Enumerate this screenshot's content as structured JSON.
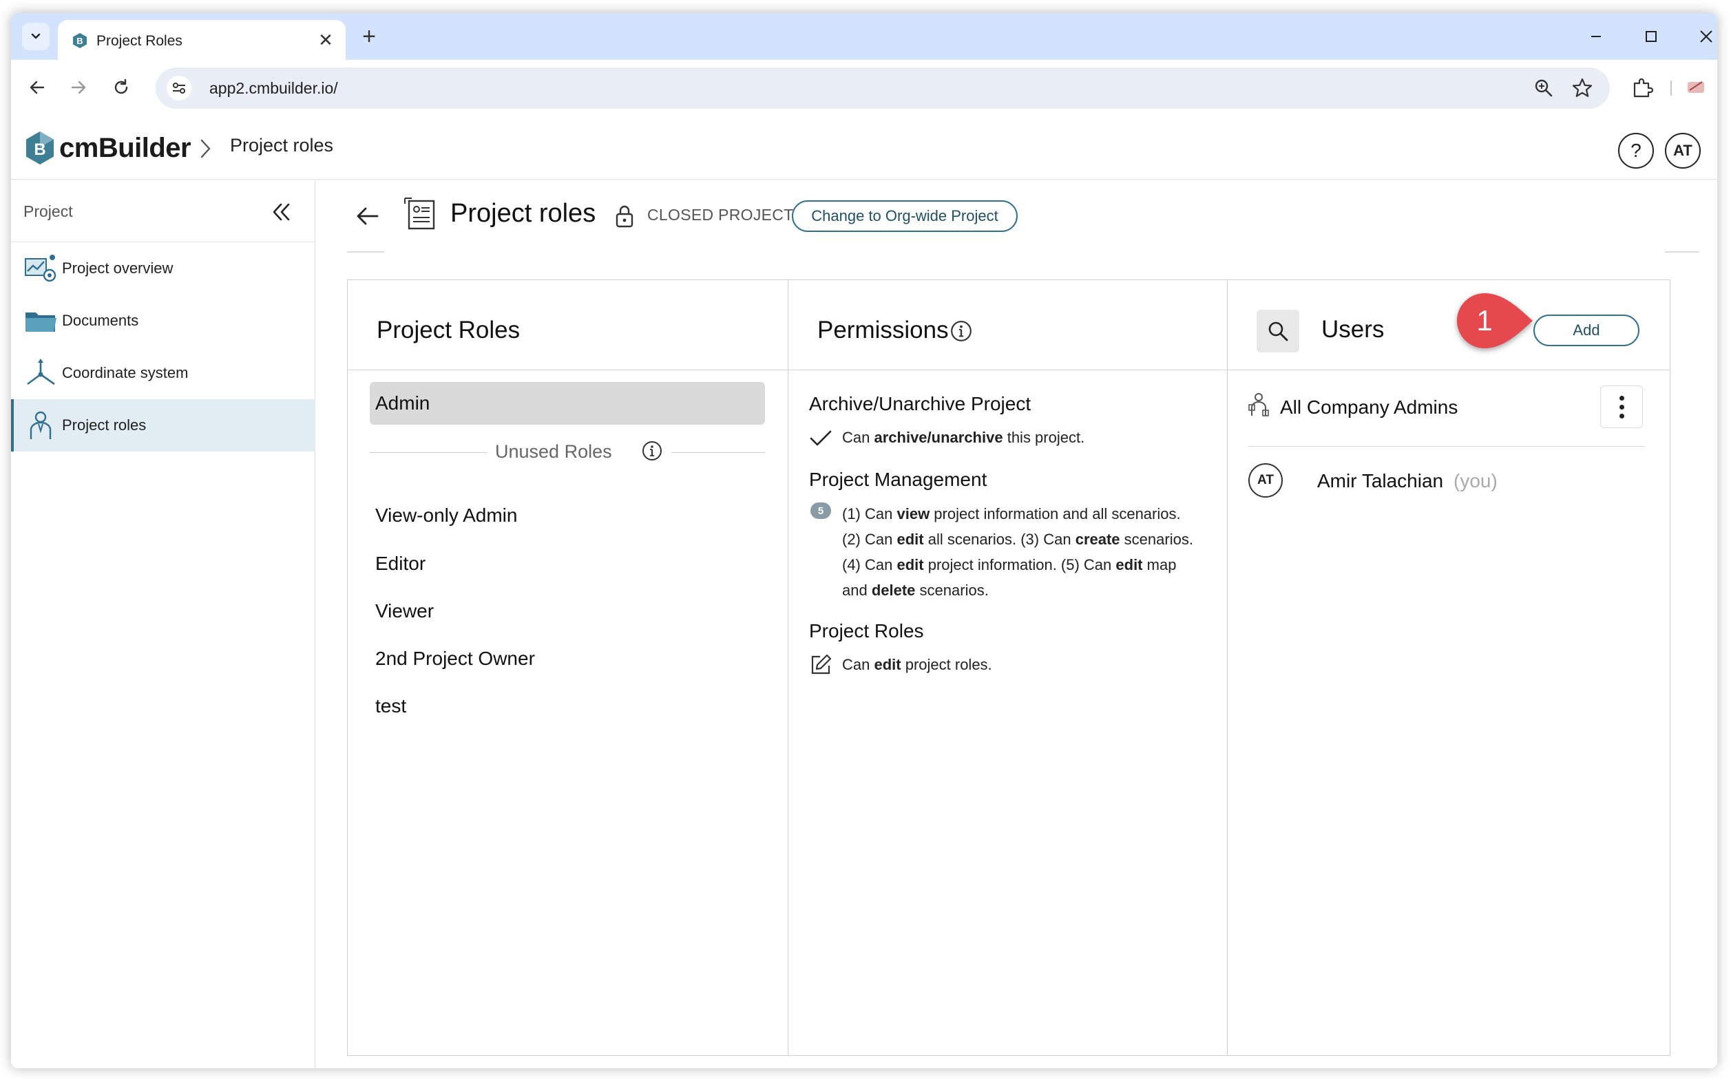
{
  "browser": {
    "tab_title": "Project Roles",
    "url": "app2.cmbuilder.io/",
    "new_tab_symbol": "+",
    "close_symbol": "✕"
  },
  "app": {
    "brand": "cmBuilder",
    "breadcrumb": "Project roles",
    "help_symbol": "?",
    "user_initials": "AT"
  },
  "sidebar": {
    "header": "Project",
    "items": [
      {
        "label": "Project overview",
        "icon": "project-overview-icon"
      },
      {
        "label": "Documents",
        "icon": "folder-icon"
      },
      {
        "label": "Coordinate system",
        "icon": "coordinate-axes-icon"
      },
      {
        "label": "Project roles",
        "icon": "person-badge-icon",
        "active": true
      }
    ]
  },
  "page": {
    "title": "Project roles",
    "status": "CLOSED PROJECT",
    "org_button": "Change to Org-wide Project"
  },
  "roles_panel": {
    "title": "Project Roles",
    "selected": "Admin",
    "unused_label": "Unused Roles",
    "unused": [
      "View-only Admin",
      "Editor",
      "Viewer",
      "2nd Project Owner",
      "test"
    ]
  },
  "permissions_panel": {
    "title": "Permissions",
    "sections": [
      {
        "title": "Archive/Unarchive Project",
        "line1": {
          "pre": "Can ",
          "bold": "archive/unarchive",
          "post": " this project."
        }
      },
      {
        "title": "Project Management",
        "badge": "5",
        "lines": [
          "(1) Can <b>view</b> project information and all scenarios.",
          "(2) Can <b>edit</b> all scenarios. (3) Can <b>create</b> scenarios.",
          "(4) Can <b>edit</b> project information. (5) Can <b>edit</b> map",
          "and <b>delete</b> scenarios."
        ]
      },
      {
        "title": "Project Roles",
        "line1": {
          "pre": "Can ",
          "bold": "edit",
          "post": " project roles."
        }
      }
    ]
  },
  "users_panel": {
    "title": "Users",
    "add_label": "Add",
    "step_number": "1",
    "group": "All Company Admins",
    "users": [
      {
        "initials": "AT",
        "name": "Amir Talachian",
        "suffix": "(you)"
      }
    ]
  },
  "colors": {
    "accent": "#2f6f8f",
    "tab_strip": "#d3e3fd",
    "step_marker": "#e5484d",
    "active_sidebar": "#e1edf2"
  }
}
